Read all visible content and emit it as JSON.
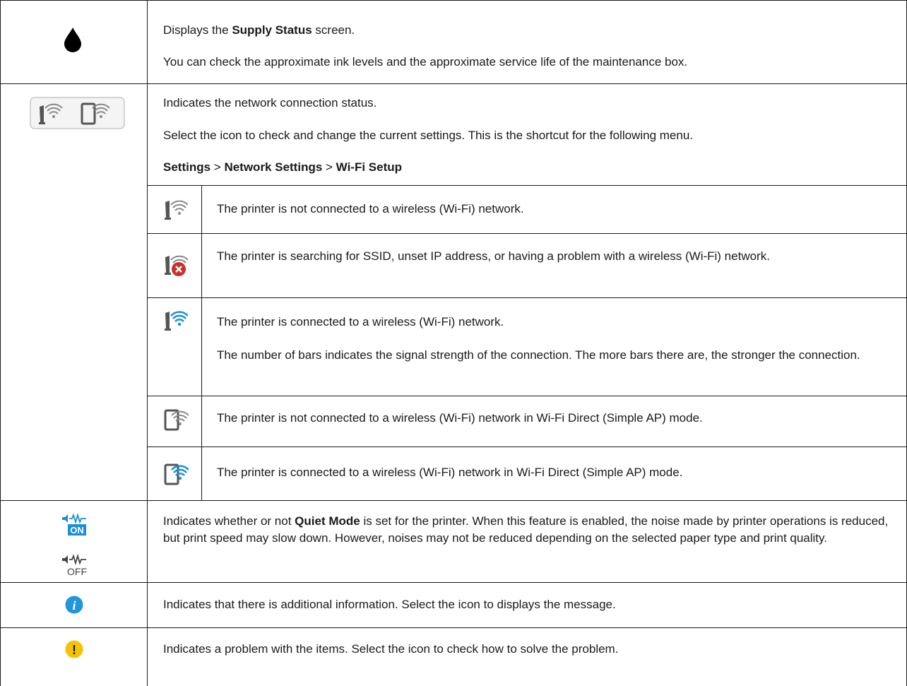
{
  "supply_row": {
    "icon": "ink-drop-icon",
    "line1_pre": "Displays the ",
    "line1_bold": "Supply Status",
    "line1_post": " screen.",
    "line2": "You can check the approximate ink levels and the approximate service life of the maintenance box."
  },
  "network_row": {
    "icon": "network-status-icons",
    "line1": "Indicates the network connection status.",
    "line2": "Select the icon to check and change the current settings. This is the shortcut for the following menu.",
    "path": {
      "settings": "Settings",
      "sep1": " > ",
      "network_settings": "Network Settings",
      "sep2": " > ",
      "wifi_setup": "Wi-Fi Setup"
    },
    "sub_rows": [
      {
        "icon": "wifi-not-connected-icon",
        "text": "The printer is not connected to a wireless (Wi-Fi) network."
      },
      {
        "icon": "wifi-error-icon",
        "text": "The printer is searching for SSID, unset IP address, or having a problem with a wireless (Wi-Fi) network."
      },
      {
        "icon": "wifi-connected-icon",
        "text": "The printer is connected to a wireless (Wi-Fi) network.",
        "text2": "The number of bars indicates the signal strength of the connection. The more bars there are, the stronger the connection."
      },
      {
        "icon": "wifi-direct-not-connected-icon",
        "text": "The printer is not connected to a wireless (Wi-Fi) network in Wi-Fi Direct (Simple AP) mode."
      },
      {
        "icon": "wifi-direct-connected-icon",
        "text": "The printer is connected to a wireless (Wi-Fi) network in Wi-Fi Direct (Simple AP) mode."
      }
    ]
  },
  "quiet_row": {
    "icon_on": "quiet-mode-on-icon",
    "icon_on_label": "ON",
    "icon_off": "quiet-mode-off-icon",
    "icon_off_label": "OFF",
    "text_pre": "Indicates whether or not ",
    "text_bold": "Quiet Mode",
    "text_post": " is set for the printer. When this feature is enabled, the noise made by printer operations is reduced, but print speed may slow down. However, noises may not be reduced depending on the selected paper type and print quality."
  },
  "info_row": {
    "icon": "info-icon",
    "icon_glyph": "i",
    "text": "Indicates that there is additional information. Select the icon to displays the message."
  },
  "warning_row": {
    "icon": "warning-icon",
    "icon_glyph": "!",
    "text": "Indicates a problem with the items. Select the icon to check how to solve the problem."
  },
  "colors": {
    "wifi_gray": "#888888",
    "wifi_blue": "#1e90d6",
    "error_red": "#c8312b",
    "quiet_blue": "#1a8fd6",
    "info_blue": "#2196d9",
    "warning_yellow": "#f5c400"
  }
}
